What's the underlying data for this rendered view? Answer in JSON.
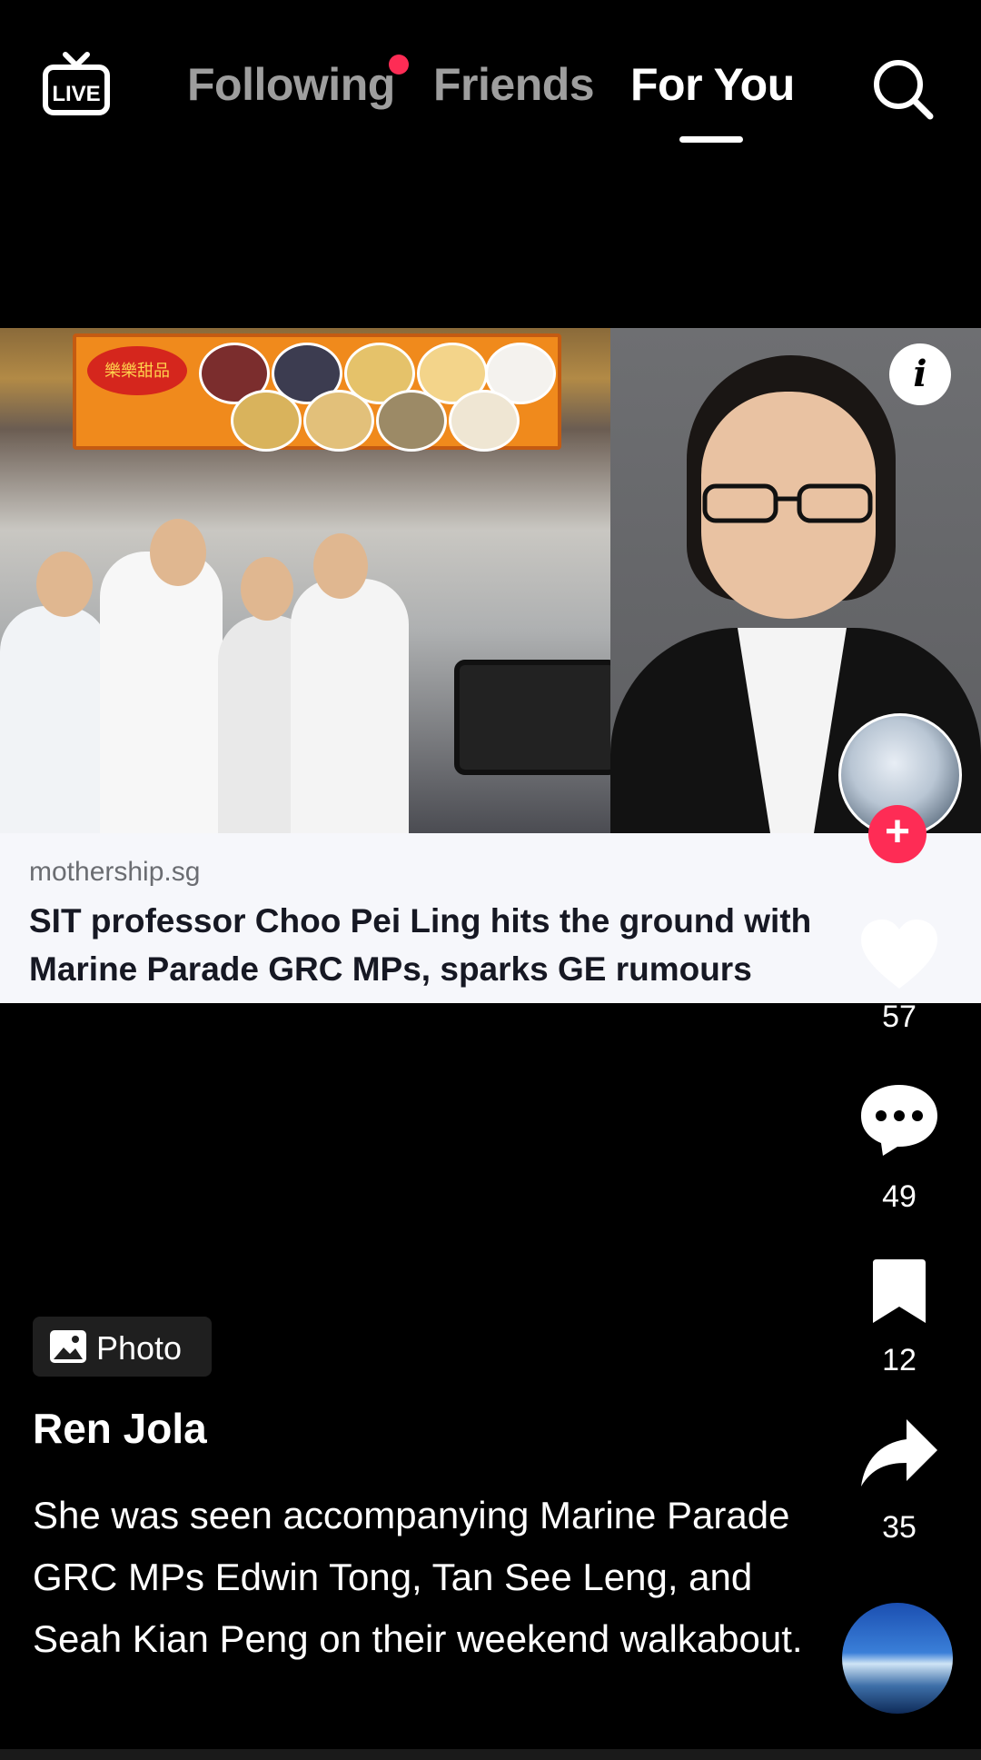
{
  "nav": {
    "live_label": "LIVE",
    "tabs": [
      {
        "label": "Following",
        "active": false,
        "has_notification": true
      },
      {
        "label": "Friends",
        "active": false
      },
      {
        "label": "For You",
        "active": true
      }
    ],
    "icons": {
      "live": "live-tv-icon",
      "search": "search-icon"
    }
  },
  "post": {
    "type_badge": "Photo",
    "author": "Ren Jola",
    "caption": "She was seen accompanying Marine Parade GRC MPs Edwin Tong, Tan See Leng, and Seah Kian Peng on their weekend walkabout.",
    "link_card": {
      "domain": "mothership.sg",
      "title": "SIT professor Choo Pei Ling hits the ground with Marine Parade GRC MPs, sparks GE rumours"
    }
  },
  "actions": {
    "likes": "57",
    "comments": "49",
    "saves": "12",
    "shares": "35"
  },
  "colors": {
    "accent": "#fe2c55",
    "tab_inactive": "#9e9e9e",
    "background": "#000000",
    "link_card_bg": "#f6f7fb"
  }
}
